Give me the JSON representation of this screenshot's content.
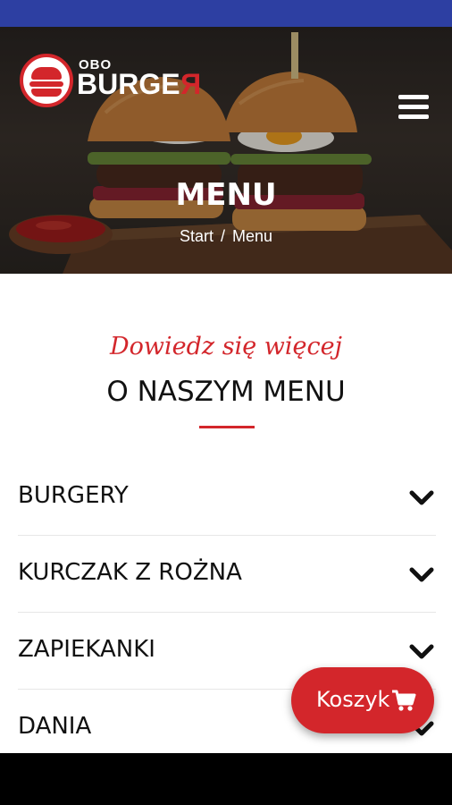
{
  "header": {
    "logo_small": "OBO",
    "logo_main_prefix": "BURGE",
    "logo_main_suffix": "R",
    "title": "MENU",
    "breadcrumb": [
      "Start",
      "Menu"
    ],
    "breadcrumb_separator": "/"
  },
  "intro": {
    "subtitle": "Dowiedz się więcej",
    "title": "O NASZYM MENU"
  },
  "categories": [
    {
      "label": "BURGERY",
      "icon": "chevron-down-icon"
    },
    {
      "label": "KURCZAK Z ROŻNA",
      "icon": "chevron-down-icon"
    },
    {
      "label": "ZAPIEKANKI",
      "icon": "chevron-down-icon"
    },
    {
      "label": "DANIA",
      "icon": "chevron-down-icon"
    }
  ],
  "cart": {
    "label": "Koszyk",
    "icon": "cart-icon"
  },
  "colors": {
    "accent": "#d3262b",
    "status_bar": "#2d3fa2"
  }
}
